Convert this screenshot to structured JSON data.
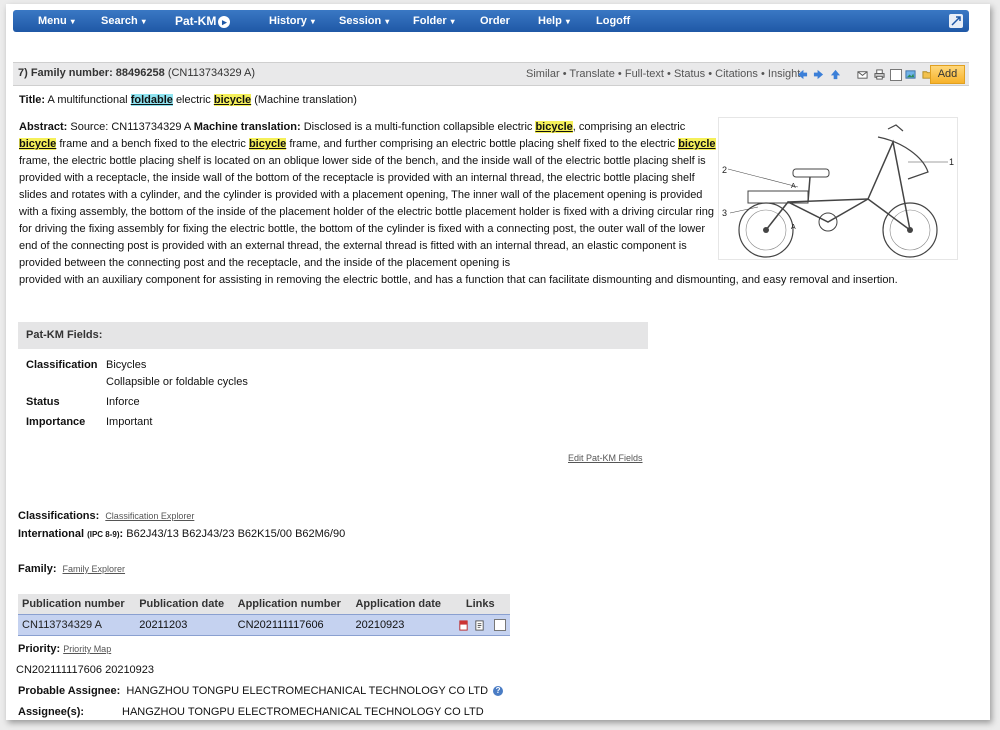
{
  "nav": {
    "items": [
      {
        "label": "Menu",
        "caret": "▾"
      },
      {
        "label": "Search",
        "caret": "▾"
      },
      {
        "label": "History",
        "caret": "▾"
      },
      {
        "label": "Session",
        "caret": "▾"
      },
      {
        "label": "Folder",
        "caret": "▾"
      },
      {
        "label": "Order",
        "caret": ""
      },
      {
        "label": "Help",
        "caret": "▾"
      },
      {
        "label": "Logoff",
        "caret": ""
      }
    ],
    "logo": "Pat-KM",
    "logo_arrow": "▸"
  },
  "family": {
    "header_label": "7) Family number: 88496258",
    "header_sub": "(CN113734329 A)",
    "links": [
      "Similar",
      "Translate",
      "Full-text",
      "Status",
      "Citations",
      "Insight"
    ],
    "separator": "•",
    "add_label": "Add"
  },
  "title": {
    "label": "Title:",
    "pre": "A multifunctional",
    "kw1": "foldable",
    "mid": "electric",
    "kw2": "bicycle",
    "post": "(Machine translation)"
  },
  "abstract": {
    "label": "Abstract:",
    "source": "Source: CN113734329 A",
    "mt_label": "Machine translation:",
    "s1": "Disclosed is a multi-function collapsible electric",
    "kw": "bicycle",
    "s2": ", comprising an electric",
    "s3": "frame and a bench fixed to the electric",
    "s4": "frame, and further comprising an electric bottle placing shelf fixed to the electric",
    "s5": "frame, the electric bottle placing shelf is located on an oblique lower side of the bench, and the inside wall of the electric bottle placing shelf is provided with a receptacle, the inside wall of the bottom of the receptacle is provided with an internal thread, the electric bottle placing shelf slides and rotates with a cylinder, and the cylinder is provided with a placement opening, The inner wall of the placement opening is provided with a fixing assembly, the bottom of the inside of the placement holder of the electric bottle placement holder is fixed with a driving circular ring for driving the fixing assembly for fixing the electric bottle, the bottom of the cylinder is fixed with a connecting post, the outer wall of the lower end of the connecting post is provided with an external thread, the external thread is fitted with an internal thread, an elastic component is provided between the connecting post and the receptacle, and the inside of the placement opening is",
    "tail": "provided with an auxiliary component for assisting in removing the electric bottle, and has a function that can facilitate dismounting and dismounting, and easy removal and insertion."
  },
  "drawing": {
    "l1": "1",
    "l2": "2",
    "l3": "3",
    "la": "A"
  },
  "patkm": {
    "title": "Pat-KM Fields:",
    "classification_key": "Classification",
    "classification_v1": "Bicycles",
    "classification_v2": "Collapsible or foldable cycles",
    "status_key": "Status",
    "status_val": "Inforce",
    "importance_key": "Importance",
    "importance_val": "Important",
    "edit": "Edit Pat-KM Fields"
  },
  "classifications": {
    "label": "Classifications:",
    "link": "Classification Explorer",
    "intl_label": "International",
    "intl_sub": "(IPC 8-9)",
    "codes": "B62J43/13 B62J43/23 B62K15/00 B62M6/90"
  },
  "family_section": {
    "label": "Family:",
    "link": "Family Explorer",
    "columns": [
      "Publication number",
      "Publication date",
      "Application number",
      "Application date",
      "Links"
    ],
    "row": {
      "pub": "CN113734329 A",
      "pubdate": "20211203",
      "app": "CN202111117606",
      "appdate": "20210923"
    }
  },
  "priority": {
    "label": "Priority:",
    "link": "Priority Map",
    "value": "CN202111117606 20210923"
  },
  "assignee": {
    "probable_label": "Probable Assignee:",
    "probable_val": "HANGZHOU TONGPU ELECTROMECHANICAL TECHNOLOGY CO LTD",
    "assignees_label": "Assignee(s):",
    "assignees_val": "HANGZHOU TONGPU ELECTROMECHANICAL TECHNOLOGY CO LTD",
    "help": "?"
  }
}
